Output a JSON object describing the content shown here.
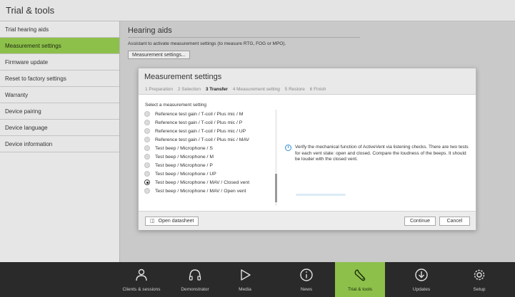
{
  "window": {
    "title": "Trial & tools"
  },
  "sidebar": {
    "items": [
      {
        "label": "Trial hearing aids",
        "active": false
      },
      {
        "label": "Measurement settings",
        "active": true
      },
      {
        "label": "Firmware update",
        "active": false
      },
      {
        "label": "Reset to factory settings",
        "active": false
      },
      {
        "label": "Warranty",
        "active": false
      },
      {
        "label": "Device pairing",
        "active": false
      },
      {
        "label": "Device language",
        "active": false
      },
      {
        "label": "Device information",
        "active": false
      }
    ]
  },
  "main": {
    "heading": "Hearing aids",
    "description": "Assistant to activate measurement settings (to measure RTG, FOG or MPO).",
    "button_label": "Measurement settings..."
  },
  "dialog": {
    "title": "Measurement settings",
    "steps": [
      {
        "label": "1 Preparation",
        "current": false
      },
      {
        "label": "2 Selection",
        "current": false
      },
      {
        "label": "3 Transfer",
        "current": true
      },
      {
        "label": "4 Measurement setting",
        "current": false
      },
      {
        "label": "5 Restore",
        "current": false
      },
      {
        "label": "6 Finish",
        "current": false
      }
    ],
    "select_label": "Select a measurement setting",
    "options": [
      {
        "label": "Reference test gain / T-coil / Plus mic / M",
        "selected": false
      },
      {
        "label": "Reference test gain / T-coil / Plus mic / P",
        "selected": false
      },
      {
        "label": "Reference test gain / T-coil / Plus mic / UP",
        "selected": false
      },
      {
        "label": "Reference test gain / T-coil / Plus mic / MAV",
        "selected": false
      },
      {
        "label": "Test beep / Microphone / S",
        "selected": false
      },
      {
        "label": "Test beep / Microphone / M",
        "selected": false
      },
      {
        "label": "Test beep / Microphone / P",
        "selected": false
      },
      {
        "label": "Test beep / Microphone / UP",
        "selected": false
      },
      {
        "label": "Test beep / Microphone / MAV / Closed vent",
        "selected": true
      },
      {
        "label": "Test beep / Microphone / MAV / Open vent",
        "selected": false
      }
    ],
    "info_text": "Verify the mechanical function of ActiveVent via listening checks. There are two tests for each vent state: open and closed. Compare the loudness of the beeps. It should be louder with the closed vent.",
    "open_datasheet_label": "Open datasheet",
    "continue_label": "Continue",
    "cancel_label": "Cancel"
  },
  "bottom_nav": [
    {
      "label": "Clients & sessions",
      "icon": "person-icon",
      "active": false
    },
    {
      "label": "Demonstrator",
      "icon": "headphones-icon",
      "active": false
    },
    {
      "label": "Media",
      "icon": "play-icon",
      "active": false
    },
    {
      "label": "News",
      "icon": "info-icon",
      "active": false
    },
    {
      "label": "Trial & tools",
      "icon": "wrench-icon",
      "active": true
    },
    {
      "label": "Updates",
      "icon": "download-icon",
      "active": false
    },
    {
      "label": "Setup",
      "icon": "gear-icon",
      "active": false
    }
  ],
  "colors": {
    "accent": "#8dc04a",
    "bottom_bar": "#2a2a2a",
    "info_blue": "#2f8fd8"
  }
}
